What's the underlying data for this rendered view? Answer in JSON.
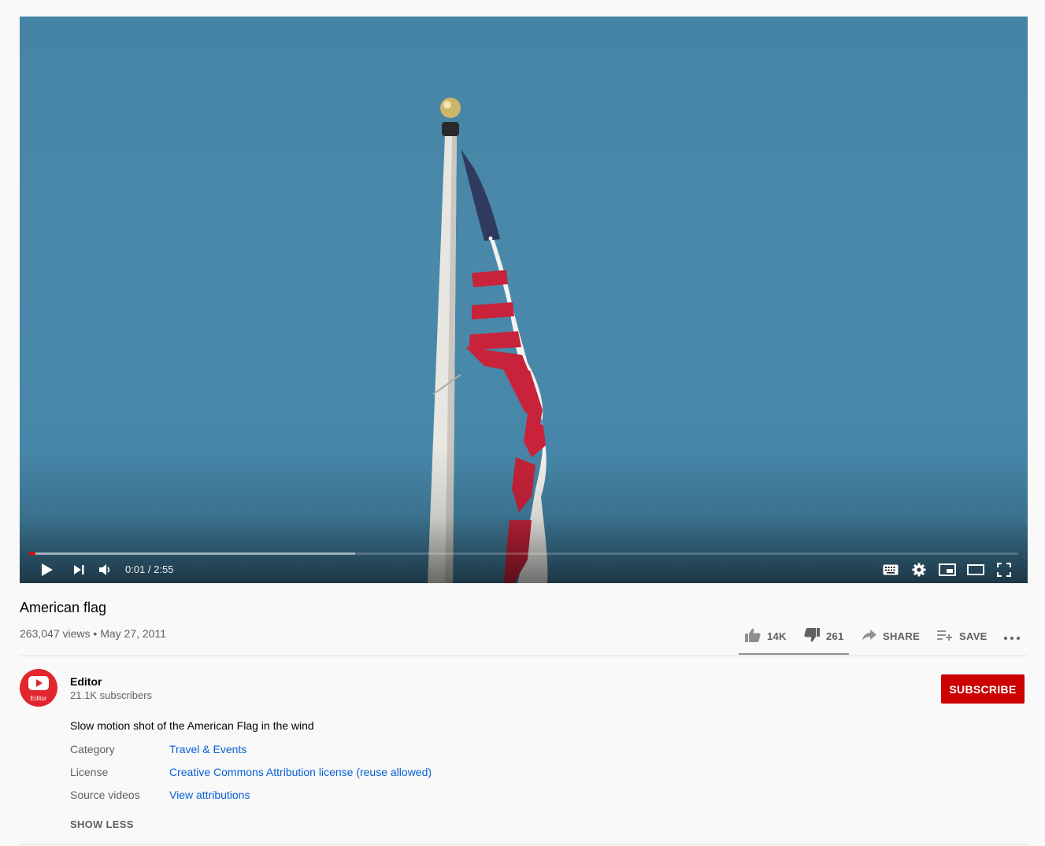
{
  "player": {
    "time_display": "0:01 / 2:55",
    "progress_fraction": 0.006,
    "buffered_fraction": 0.33,
    "progress_color": "#ff0000",
    "icons": {
      "play": "play-icon",
      "next": "next-icon",
      "volume": "volume-icon",
      "subtitles": "keyboard-icon",
      "settings": "gear-icon",
      "miniplayer": "miniplayer-icon",
      "theater": "theater-mode-icon",
      "fullscreen": "fullscreen-icon"
    }
  },
  "video": {
    "title": "American flag",
    "views": "263,047 views",
    "separator": "•",
    "date": "May 27, 2011"
  },
  "actions": {
    "like_count": "14K",
    "dislike_count": "261",
    "share_label": "SHARE",
    "save_label": "SAVE",
    "like_fraction": 0.982
  },
  "channel": {
    "name": "Editor",
    "subscribers": "21.1K subscribers",
    "avatar_label": "Editor",
    "subscribe_label": "SUBSCRIBE",
    "brand_color": "#cc0000"
  },
  "description": {
    "text": "Slow motion shot of the American Flag in the wind",
    "rows": [
      {
        "key": "Category",
        "value": "Travel & Events"
      },
      {
        "key": "License",
        "value": "Creative Commons Attribution license (reuse allowed)"
      },
      {
        "key": "Source videos",
        "value": "View attributions"
      }
    ],
    "show_less_label": "SHOW LESS"
  }
}
